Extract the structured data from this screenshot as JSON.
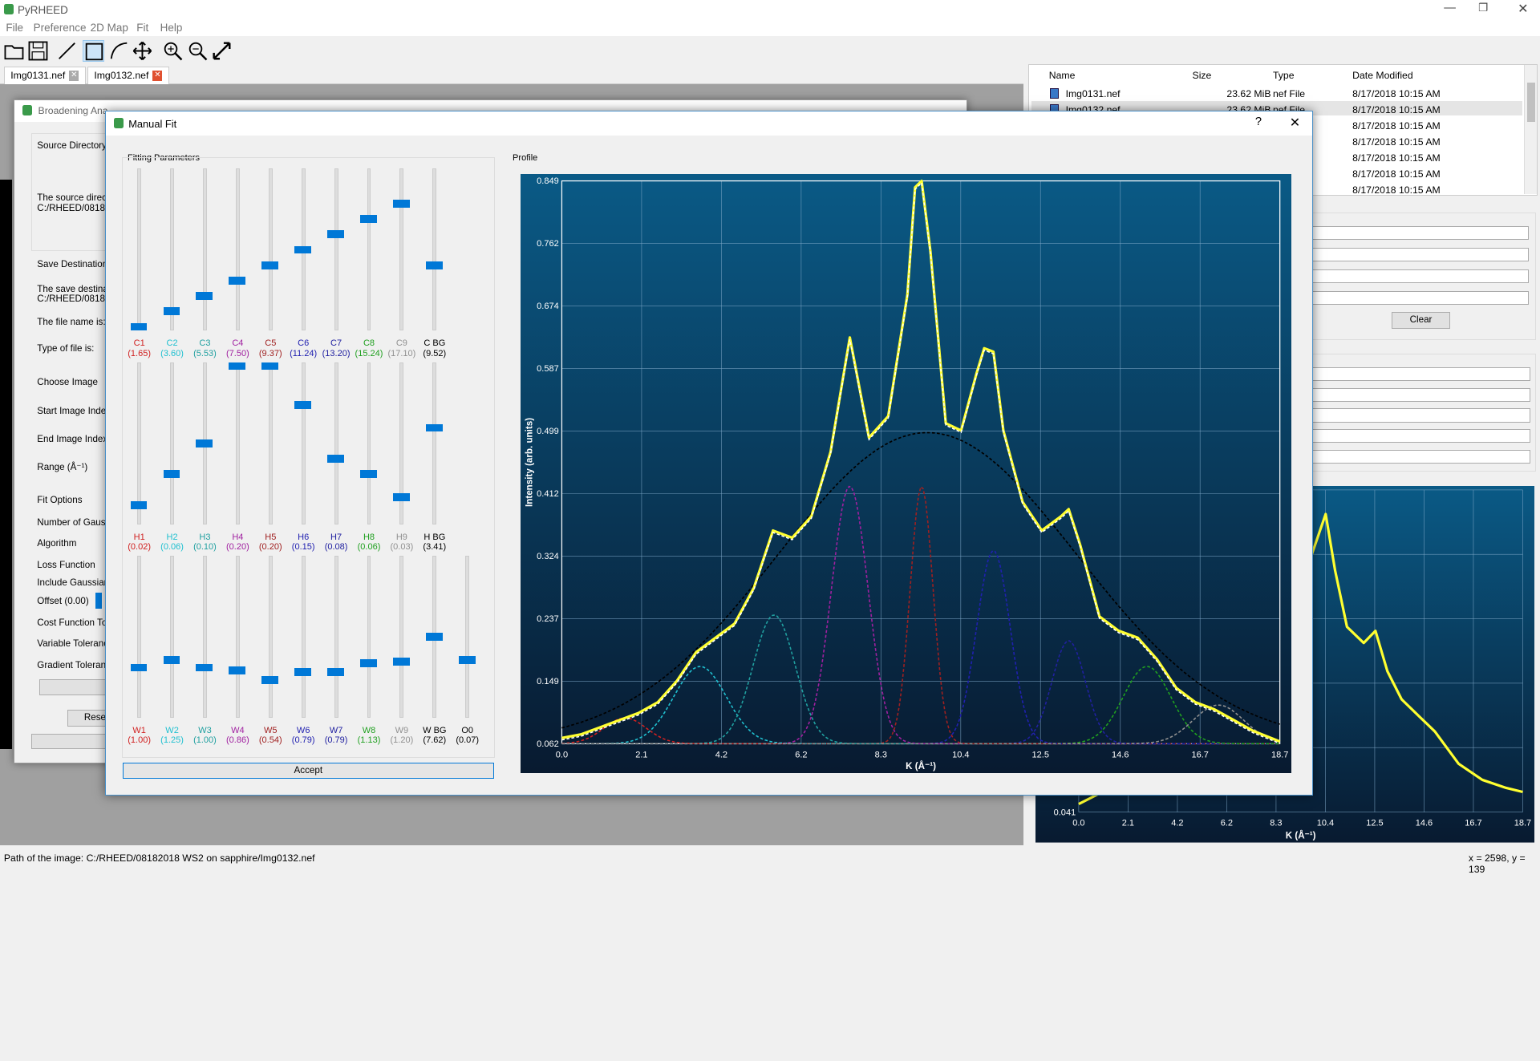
{
  "app": {
    "title": "PyRHEED",
    "coord_readout": "x = 2598, y = 139",
    "path": "Path of the image: C:/RHEED/08182018 WS2 on sapphire/Img0132.nef"
  },
  "menu": [
    "File",
    "Preference",
    "2D Map",
    "Fit",
    "Help"
  ],
  "toolbar": {
    "icons": [
      "open-folder-icon",
      "save-icon",
      "line-tool-icon",
      "rect-select-icon",
      "arc-tool-icon",
      "pan-icon",
      "zoom-in-icon",
      "zoom-out-icon",
      "fullscreen-icon"
    ]
  },
  "tabs": [
    {
      "label": "Img0131.nef"
    },
    {
      "label": "Img0132.nef"
    }
  ],
  "files": {
    "headers": {
      "name": "Name",
      "size": "Size",
      "type": "Type",
      "date": "Date Modified"
    },
    "rows": [
      {
        "name": "Img0131.nef",
        "size": "23.62 MiB",
        "type": "nef File",
        "date": "8/17/2018 10:15 AM"
      },
      {
        "name": "Img0132.nef",
        "size": "23.62 MiB",
        "type": "nef File",
        "date": "8/17/2018 10:15 AM"
      },
      {
        "name": "",
        "size": "",
        "type": "",
        "date": "8/17/2018 10:15 AM"
      },
      {
        "name": "",
        "size": "",
        "type": "",
        "date": "8/17/2018 10:15 AM"
      },
      {
        "name": "",
        "size": "",
        "type": "",
        "date": "8/17/2018 10:15 AM"
      },
      {
        "name": "",
        "size": "",
        "type": "",
        "date": "8/17/2018 10:15 AM"
      },
      {
        "name": "",
        "size": "",
        "type": "",
        "date": "8/17/2018 10:15 AM"
      }
    ]
  },
  "right": {
    "clear_label": "Clear"
  },
  "broad": {
    "title": "Broadening Ana",
    "source_dir": "Source Directory",
    "source_text1": "The source direct",
    "source_text2": "C:/RHEED/08182",
    "save_dest": "Save Destination",
    "save_text1": "The save destina",
    "save_text2": "C:/RHEED/08182",
    "file_name": "The file name is:",
    "file_type": "Type of file is:",
    "choose_image": "Choose Image",
    "start_index": "Start Image Inde",
    "end_index": "End Image Index",
    "range": "Range (Å⁻¹)",
    "fit_options": "Fit Options",
    "num_gauss": "Number of Gauss",
    "algorithm": "Algorithm",
    "loss": "Loss Function",
    "include": "Include Gaussian",
    "offset": "Offset (0.00)",
    "cost_tol": "Cost Function Tol",
    "var_tol": "Variable Toleranc",
    "grad_tol": "Gradient Toleranc",
    "reset": "Rese"
  },
  "manual": {
    "title": "Manual Fit",
    "help": "?",
    "close": "✕",
    "params_label": "Fitting Parameters",
    "profile_label": "Profile",
    "accept": "Accept"
  },
  "sliders": {
    "C": [
      {
        "n": "C1",
        "v": "(1.65)",
        "c": "#d02020",
        "pos": 0.0
      },
      {
        "n": "C2",
        "v": "(3.60)",
        "c": "#20c0d0",
        "pos": 0.1
      },
      {
        "n": "C3",
        "v": "(5.53)",
        "c": "#20a0a0",
        "pos": 0.2
      },
      {
        "n": "C4",
        "v": "(7.50)",
        "c": "#a020a0",
        "pos": 0.3
      },
      {
        "n": "C5",
        "v": "(9.37)",
        "c": "#a02020",
        "pos": 0.4
      },
      {
        "n": "C6",
        "v": "(11.24)",
        "c": "#2020b0",
        "pos": 0.5
      },
      {
        "n": "C7",
        "v": "(13.20)",
        "c": "#2020a0",
        "pos": 0.6
      },
      {
        "n": "C8",
        "v": "(15.24)",
        "c": "#20a020",
        "pos": 0.7
      },
      {
        "n": "C9",
        "v": "(17.10)",
        "c": "#909090",
        "pos": 0.8
      },
      {
        "n": "C BG",
        "v": "(9.52)",
        "c": "#000000",
        "pos": 0.4
      }
    ],
    "H": [
      {
        "n": "H1",
        "v": "(0.02)",
        "c": "#d02020",
        "pos": 0.1
      },
      {
        "n": "H2",
        "v": "(0.06)",
        "c": "#20c0d0",
        "pos": 0.3
      },
      {
        "n": "H3",
        "v": "(0.10)",
        "c": "#20a0a0",
        "pos": 0.5
      },
      {
        "n": "H4",
        "v": "(0.20)",
        "c": "#a020a0",
        "pos": 1.0
      },
      {
        "n": "H5",
        "v": "(0.20)",
        "c": "#a02020",
        "pos": 1.0
      },
      {
        "n": "H6",
        "v": "(0.15)",
        "c": "#2020b0",
        "pos": 0.75
      },
      {
        "n": "H7",
        "v": "(0.08)",
        "c": "#2020a0",
        "pos": 0.4
      },
      {
        "n": "H8",
        "v": "(0.06)",
        "c": "#20a020",
        "pos": 0.3
      },
      {
        "n": "H9",
        "v": "(0.03)",
        "c": "#909090",
        "pos": 0.15
      },
      {
        "n": "H BG",
        "v": "(3.41)",
        "c": "#000000",
        "pos": 0.6
      }
    ],
    "W": [
      {
        "n": "W1",
        "v": "(1.00)",
        "c": "#d02020",
        "pos": 0.3
      },
      {
        "n": "W2",
        "v": "(1.25)",
        "c": "#20c0d0",
        "pos": 0.35
      },
      {
        "n": "W3",
        "v": "(1.00)",
        "c": "#20a0a0",
        "pos": 0.3
      },
      {
        "n": "W4",
        "v": "(0.86)",
        "c": "#a020a0",
        "pos": 0.28
      },
      {
        "n": "W5",
        "v": "(0.54)",
        "c": "#a02020",
        "pos": 0.22
      },
      {
        "n": "W6",
        "v": "(0.79)",
        "c": "#2020b0",
        "pos": 0.27
      },
      {
        "n": "W7",
        "v": "(0.79)",
        "c": "#2020a0",
        "pos": 0.27
      },
      {
        "n": "W8",
        "v": "(1.13)",
        "c": "#20a020",
        "pos": 0.33
      },
      {
        "n": "W9",
        "v": "(1.20)",
        "c": "#909090",
        "pos": 0.34
      },
      {
        "n": "W BG",
        "v": "(7.62)",
        "c": "#000000",
        "pos": 0.5
      },
      {
        "n": "O0",
        "v": "(0.07)",
        "c": "#000000",
        "pos": 0.35
      }
    ]
  },
  "chart_data": {
    "type": "line",
    "ylabel": "Intensity (arb. units)",
    "xlabel": "K (Å⁻¹)",
    "xlim": [
      0.0,
      18.7
    ],
    "ylim": [
      0.062,
      0.849
    ],
    "xticks": [
      "0.0",
      "2.1",
      "4.2",
      "6.2",
      "8.3",
      "10.4",
      "12.5",
      "14.6",
      "16.7",
      "18.7"
    ],
    "yticks": [
      "0.849",
      "0.762",
      "0.674",
      "0.587",
      "0.499",
      "0.412",
      "0.324",
      "0.237",
      "0.149",
      "0.062"
    ],
    "grid": true,
    "gaussians": [
      {
        "center": 1.65,
        "height": 0.02,
        "width": 1.0,
        "color": "#d02020"
      },
      {
        "center": 3.6,
        "height": 0.06,
        "width": 1.25,
        "color": "#20c0d0"
      },
      {
        "center": 5.53,
        "height": 0.1,
        "width": 1.0,
        "color": "#20a0a0"
      },
      {
        "center": 7.5,
        "height": 0.2,
        "width": 0.86,
        "color": "#a020a0"
      },
      {
        "center": 9.37,
        "height": 0.2,
        "width": 0.54,
        "color": "#a02020"
      },
      {
        "center": 11.24,
        "height": 0.15,
        "width": 0.79,
        "color": "#2020b0"
      },
      {
        "center": 13.2,
        "height": 0.08,
        "width": 0.79,
        "color": "#2020a0"
      },
      {
        "center": 15.24,
        "height": 0.06,
        "width": 1.13,
        "color": "#20a020"
      },
      {
        "center": 17.1,
        "height": 0.03,
        "width": 1.2,
        "color": "#909090"
      }
    ],
    "background": {
      "center": 9.52,
      "height": 3.41,
      "width": 7.62,
      "offset": 0.07
    },
    "profile": {
      "x": [
        0.0,
        0.5,
        1.0,
        1.5,
        2.0,
        2.5,
        3.0,
        3.5,
        4.0,
        4.5,
        5.0,
        5.5,
        6.0,
        6.5,
        7.0,
        7.5,
        8.0,
        8.5,
        9.0,
        9.2,
        9.37,
        9.6,
        10.0,
        10.4,
        10.8,
        11.0,
        11.24,
        11.5,
        12.0,
        12.5,
        13.0,
        13.2,
        13.5,
        14.0,
        14.5,
        15.0,
        15.5,
        16.0,
        16.5,
        17.0,
        17.5,
        18.0,
        18.7
      ],
      "y": [
        0.07,
        0.075,
        0.085,
        0.095,
        0.105,
        0.12,
        0.15,
        0.19,
        0.21,
        0.23,
        0.28,
        0.36,
        0.35,
        0.38,
        0.47,
        0.63,
        0.49,
        0.52,
        0.69,
        0.84,
        0.849,
        0.75,
        0.51,
        0.5,
        0.58,
        0.615,
        0.61,
        0.5,
        0.4,
        0.36,
        0.38,
        0.39,
        0.34,
        0.24,
        0.22,
        0.21,
        0.18,
        0.14,
        0.12,
        0.11,
        0.095,
        0.08,
        0.065
      ]
    },
    "mini": {
      "xticks": [
        "0.0",
        "2.1",
        "4.2",
        "6.2",
        "8.3",
        "10.4",
        "12.5",
        "14.6",
        "16.7",
        "18.7"
      ],
      "ytick": "0.041",
      "xlabel": "K (Å⁻¹)"
    }
  }
}
